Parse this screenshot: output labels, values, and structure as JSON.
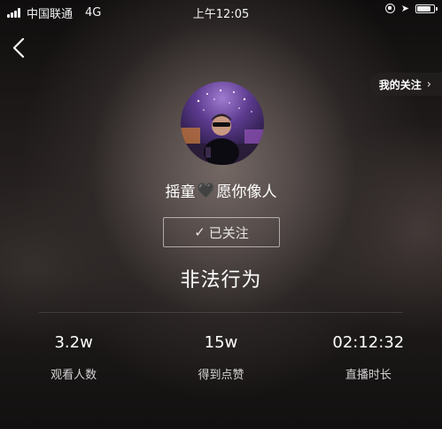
{
  "status_bar": {
    "carrier": "中国联通",
    "network": "4G",
    "time": "上午12:05"
  },
  "header": {
    "my_follows_label": "我的关注"
  },
  "profile": {
    "nickname_part1": "摇童",
    "nickname_part2": "愿你像人",
    "follow_label": "已关注",
    "end_reason": "非法行为"
  },
  "stats": [
    {
      "value": "3.2w",
      "label": "观看人数"
    },
    {
      "value": "15w",
      "label": "得到点赞"
    },
    {
      "value": "02:12:32",
      "label": "直播时长"
    }
  ],
  "icons": {
    "back": "chevron-left-icon",
    "chevron": "chevron-right-icon",
    "heart": "black-heart-icon",
    "check": "check-icon"
  }
}
